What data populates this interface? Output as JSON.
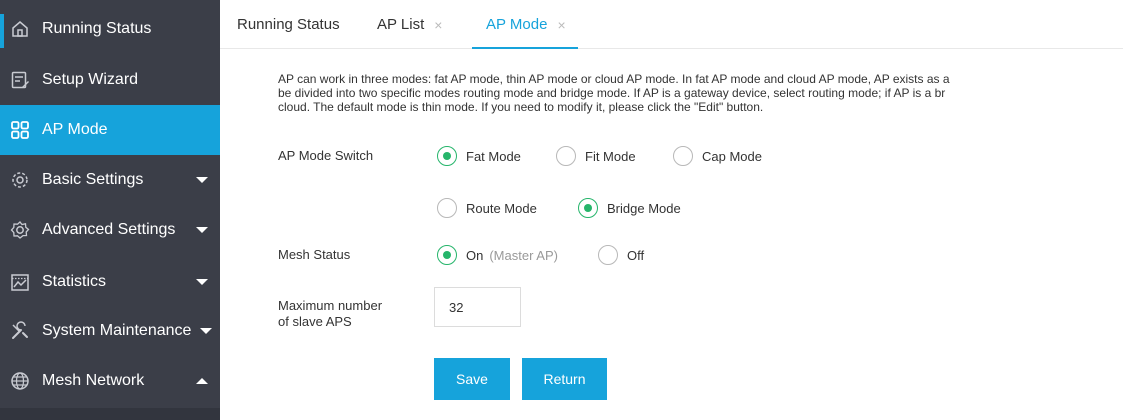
{
  "sidebar": {
    "items": [
      {
        "label": "Running Status",
        "icon": "home-icon"
      },
      {
        "label": "Setup Wizard",
        "icon": "wizard-icon"
      },
      {
        "label": "AP Mode",
        "icon": "grid-icon"
      },
      {
        "label": "Basic Settings",
        "icon": "gear-icon"
      },
      {
        "label": "Advanced Settings",
        "icon": "advanced-gear-icon"
      },
      {
        "label": "Statistics",
        "icon": "chart-icon"
      },
      {
        "label": "System Maintenance",
        "icon": "tools-icon"
      },
      {
        "label": "Mesh Network",
        "icon": "globe-icon"
      }
    ]
  },
  "tabs": [
    {
      "label": "Running Status",
      "close": ""
    },
    {
      "label": "AP List",
      "close": "×"
    },
    {
      "label": "AP Mode",
      "close": "×"
    }
  ],
  "description": {
    "line1": "AP can work in three modes: fat AP mode, thin AP mode or cloud AP mode. In fat AP mode and cloud AP mode, AP exists as a",
    "line2": "be divided into two specific modes routing mode and bridge mode. If AP is a gateway device, select routing mode; if AP is a br",
    "line3": "cloud. The default mode is thin mode. If you need to modify it, please click the \"Edit\" button."
  },
  "form": {
    "ap_mode_switch": {
      "label": "AP Mode Switch",
      "options": [
        "Fat Mode",
        "Fit Mode",
        "Cap Mode"
      ],
      "selected": "Fat Mode"
    },
    "sub_mode": {
      "options": [
        "Route Mode",
        "Bridge Mode"
      ],
      "selected": "Bridge Mode"
    },
    "mesh_status": {
      "label": "Mesh Status",
      "on_label": "On",
      "on_hint": "(Master AP)",
      "off_label": "Off",
      "selected": "On"
    },
    "max_slave": {
      "label_line1": "Maximum number",
      "label_line2": "of slave APS",
      "value": "32"
    }
  },
  "buttons": {
    "save": "Save",
    "return": "Return"
  },
  "colors": {
    "accent": "#16a3db",
    "sidebar_bg": "#3b3e48",
    "radio_checked": "#26b56b"
  }
}
